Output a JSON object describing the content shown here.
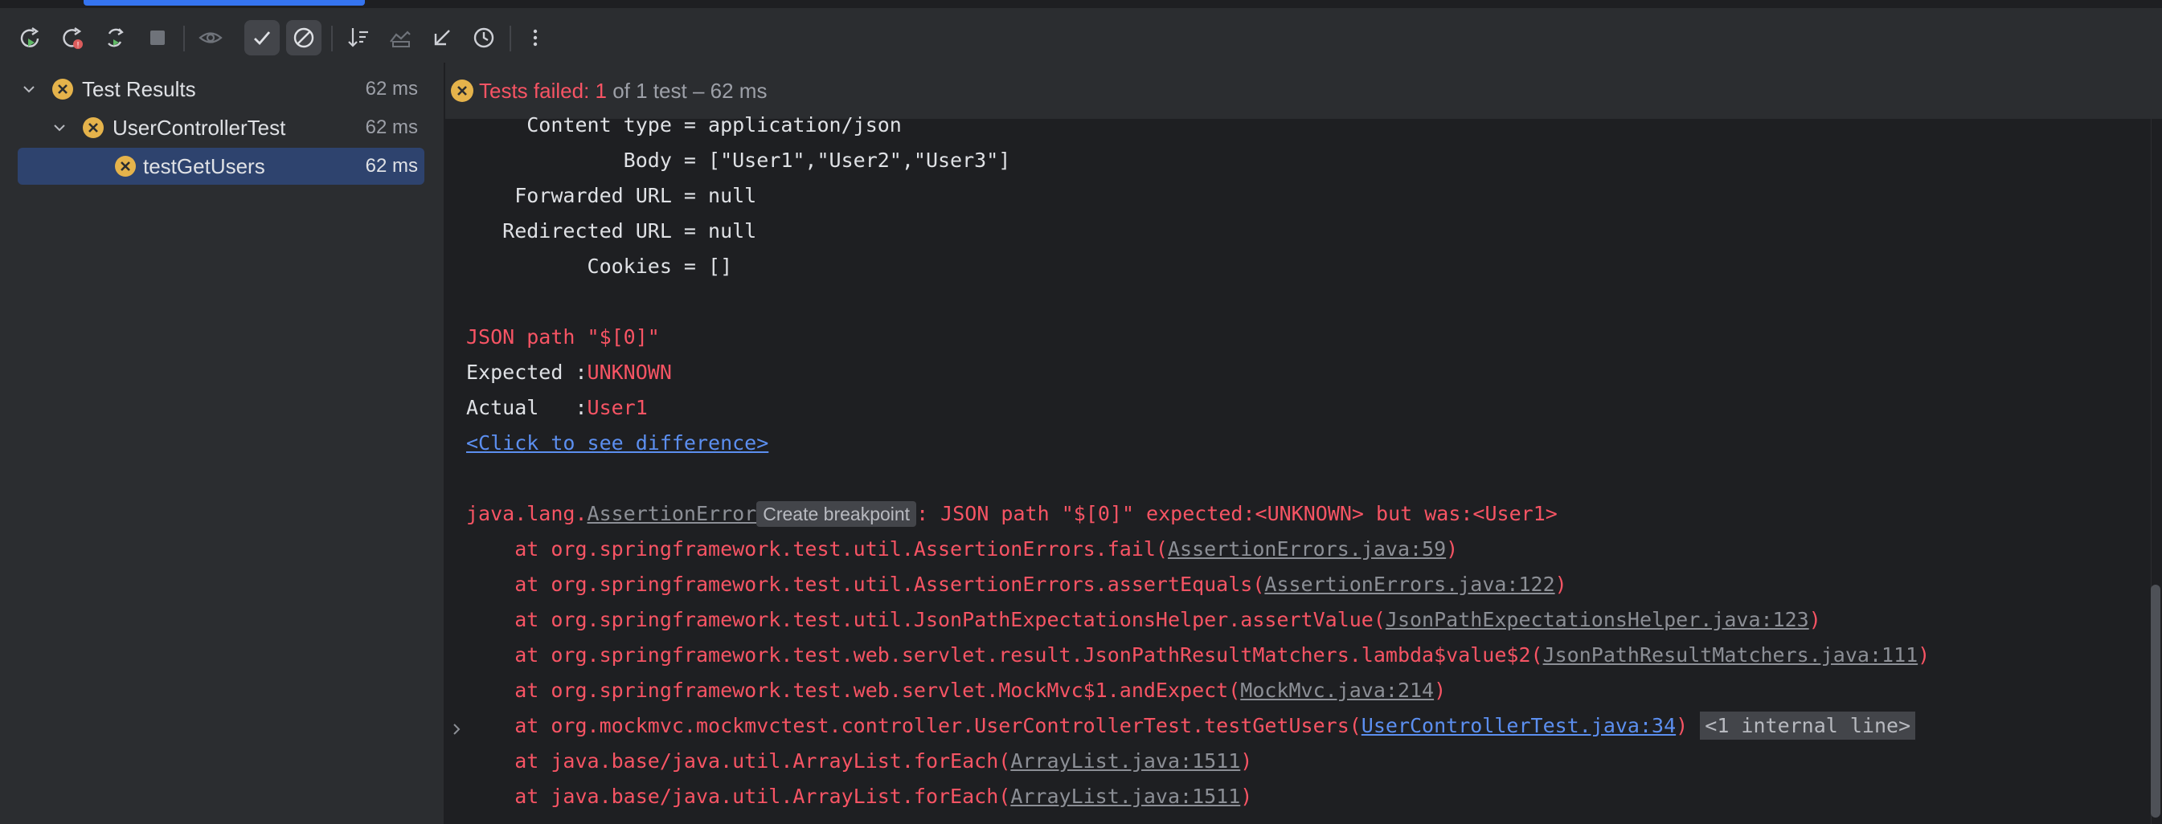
{
  "toolbar": {
    "buttons": [
      {
        "name": "rerun-icon"
      },
      {
        "name": "rerun-failed-icon"
      },
      {
        "name": "toggle-auto-test-icon"
      },
      {
        "name": "stop-icon"
      },
      {
        "name": "show-ignored-icon"
      },
      {
        "name": "show-passed-icon"
      },
      {
        "name": "show-failed-icon"
      },
      {
        "name": "sort-icon"
      },
      {
        "name": "test-runner-icon"
      },
      {
        "name": "import-tests-icon"
      },
      {
        "name": "history-icon"
      },
      {
        "name": "more-icon"
      }
    ]
  },
  "tree": {
    "items": [
      {
        "label": "Test Results",
        "time": "62 ms"
      },
      {
        "label": "UserControllerTest",
        "time": "62 ms"
      },
      {
        "label": "testGetUsers",
        "time": "62 ms"
      }
    ]
  },
  "status": {
    "prefix": "Tests failed: ",
    "failed": "1",
    "of": " of 1 test",
    "sep": " – ",
    "time": "62 ms"
  },
  "console": {
    "l0": "     Content type = application/json",
    "l1": "             Body = [\"User1\",\"User2\",\"User3\"]",
    "l2": "    Forwarded URL = null",
    "l3": "   Redirected URL = null",
    "l4": "          Cookies = []",
    "json_path": "JSON path \"$[0]\"",
    "expected_label": "Expected :",
    "expected_value": "UNKNOWN",
    "actual_label": "Actual   :",
    "actual_value": "User1",
    "diff_link": "<Click to see difference>",
    "exc_prefix": "java.lang.",
    "exc_class": "AssertionError",
    "breakpoint_chip": "Create breakpoint",
    "exc_message": ": JSON path \"$[0]\" expected:<UNKNOWN> but was:<User1>",
    "stack": [
      {
        "pre": "    at org.springframework.test.util.AssertionErrors.fail(",
        "link": "AssertionErrors.java:59",
        "post": ")"
      },
      {
        "pre": "    at org.springframework.test.util.AssertionErrors.assertEquals(",
        "link": "AssertionErrors.java:122",
        "post": ")"
      },
      {
        "pre": "    at org.springframework.test.util.JsonPathExpectationsHelper.assertValue(",
        "link": "JsonPathExpectationsHelper.java:123",
        "post": ")"
      },
      {
        "pre": "    at org.springframework.test.web.servlet.result.JsonPathResultMatchers.lambda$value$2(",
        "link": "JsonPathResultMatchers.java:111",
        "post": ")"
      },
      {
        "pre": "    at org.springframework.test.web.servlet.MockMvc$1.andExpect(",
        "link": "MockMvc.java:214",
        "post": ")"
      },
      {
        "pre": "    at org.mockmvc.mockmvctest.controller.UserControllerTest.testGetUsers(",
        "link": "UserControllerTest.java:34",
        "post": ")",
        "chip": "<1 internal line>"
      },
      {
        "pre": "    at java.base/java.util.ArrayList.forEach(",
        "link": "ArrayList.java:1511",
        "post": ")"
      },
      {
        "pre": "    at java.base/java.util.ArrayList.forEach(",
        "link": "ArrayList.java:1511",
        "post": ")"
      }
    ]
  },
  "colors": {
    "error": "#f75464",
    "link": "#5c8ff0",
    "selection": "#2e436e",
    "fail_badge": "#e5b34b"
  }
}
